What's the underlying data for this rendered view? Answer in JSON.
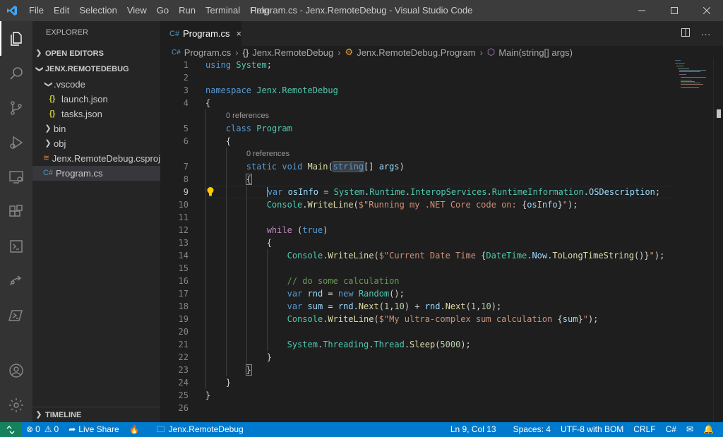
{
  "window": {
    "title": "Program.cs - Jenx.RemoteDebug - Visual Studio Code",
    "menu": [
      "File",
      "Edit",
      "Selection",
      "View",
      "Go",
      "Run",
      "Terminal",
      "Help"
    ]
  },
  "sidebar": {
    "title": "EXPLORER",
    "open_editors": "OPEN EDITORS",
    "project": "JENX.REMOTEDEBUG",
    "items": [
      {
        "label": ".vscode",
        "kind": "folder-open"
      },
      {
        "label": "launch.json",
        "kind": "json"
      },
      {
        "label": "tasks.json",
        "kind": "json"
      },
      {
        "label": "bin",
        "kind": "folder"
      },
      {
        "label": "obj",
        "kind": "folder"
      },
      {
        "label": "Jenx.RemoteDebug.csproj",
        "kind": "rss"
      },
      {
        "label": "Program.cs",
        "kind": "csharp",
        "selected": true
      }
    ],
    "timeline": "TIMELINE"
  },
  "tab": {
    "label": "Program.cs",
    "close": "×"
  },
  "breadcrumb": {
    "file": "Program.cs",
    "namespace": "Jenx.RemoteDebug",
    "class": "Jenx.RemoteDebug.Program",
    "method": "Main(string[] args)"
  },
  "editor": {
    "codelens_class": "0 references",
    "codelens_main": "0 references",
    "line_numbers": [
      "1",
      "2",
      "3",
      "4",
      "5",
      "6",
      "7",
      "8",
      "9",
      "10",
      "11",
      "12",
      "13",
      "14",
      "15",
      "16",
      "17",
      "18",
      "19",
      "20",
      "21",
      "22",
      "23",
      "24",
      "25",
      "26"
    ],
    "current_line": 9
  },
  "statusbar": {
    "errors": "0",
    "warnings": "0",
    "live_share": "Live Share",
    "folder": "Jenx.RemoteDebug",
    "position": "Ln 9, Col 13",
    "spaces": "Spaces: 4",
    "encoding": "UTF-8 with BOM",
    "eol": "CRLF",
    "language": "C#"
  },
  "colors": {
    "titlebar": "#3c3c3c",
    "activitybar": "#333333",
    "sidebar": "#252526",
    "editor": "#1e1e1e",
    "statusbar": "#007acc",
    "remote": "#16825d"
  }
}
